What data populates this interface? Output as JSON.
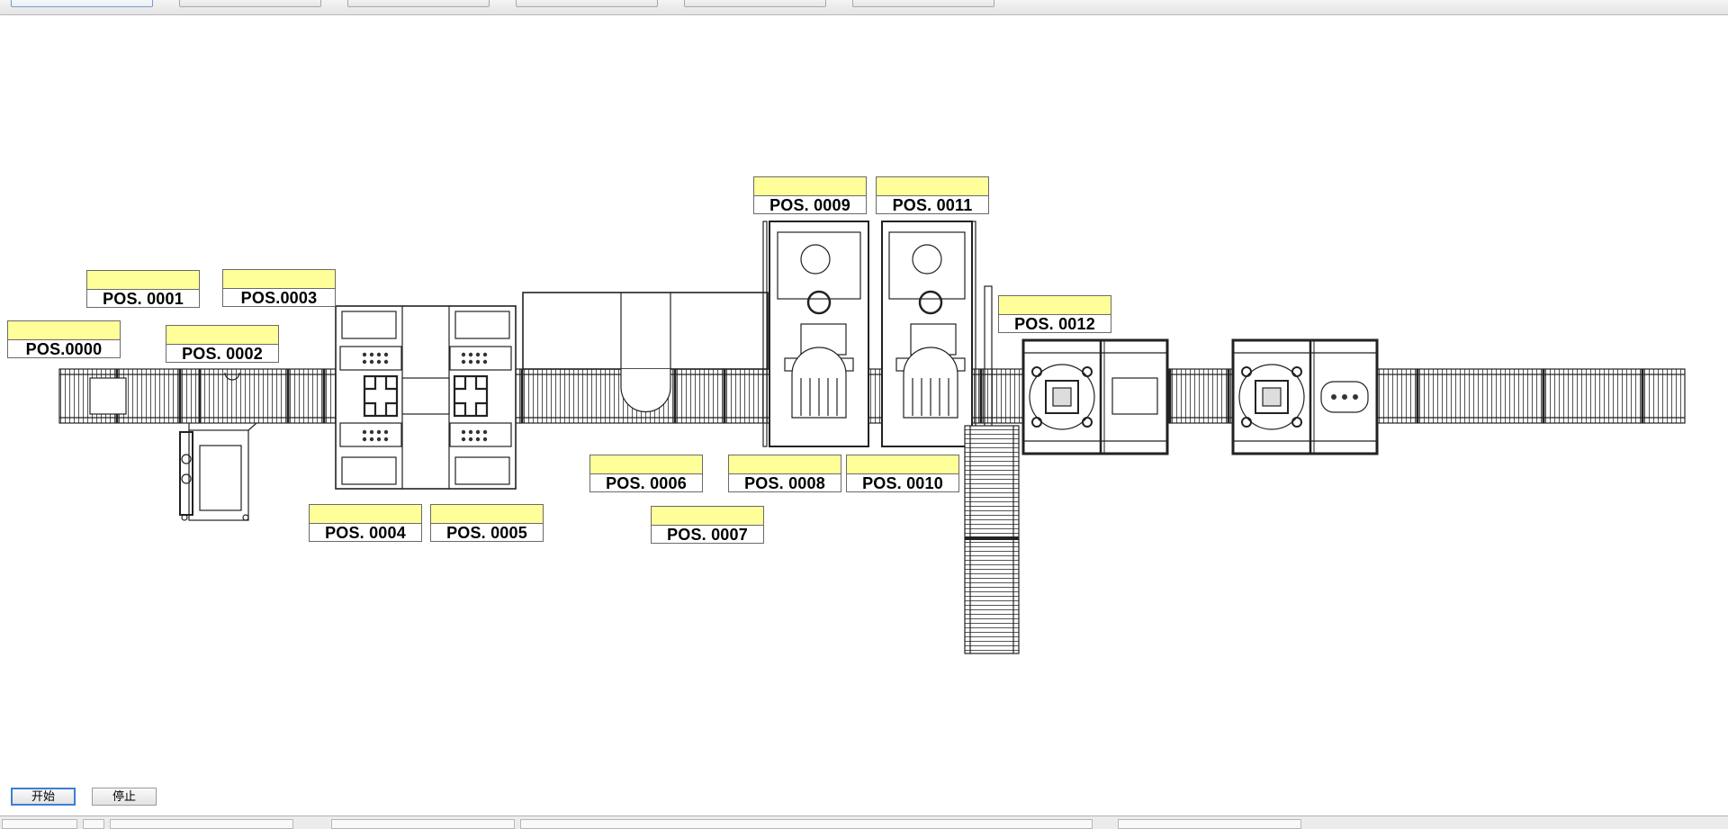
{
  "toolbar": {
    "buttons": [
      "",
      "",
      "",
      "",
      "",
      ""
    ]
  },
  "positions": {
    "p0000": "POS.0000",
    "p0001": "POS. 0001",
    "p0002": "POS. 0002",
    "p0003": "POS.0003",
    "p0004": "POS. 0004",
    "p0005": "POS. 0005",
    "p0006": "POS. 0006",
    "p0007": "POS. 0007",
    "p0008": "POS. 0008",
    "p0009": "POS. 0009",
    "p0010": "POS. 0010",
    "p0011": "POS. 0011",
    "p0012": "POS. 0012"
  },
  "controls": {
    "start_label": "开始",
    "stop_label": "停止"
  },
  "colors": {
    "label_fill": "#ffff99",
    "line": "#222222",
    "accent": "#3c7fd4"
  }
}
